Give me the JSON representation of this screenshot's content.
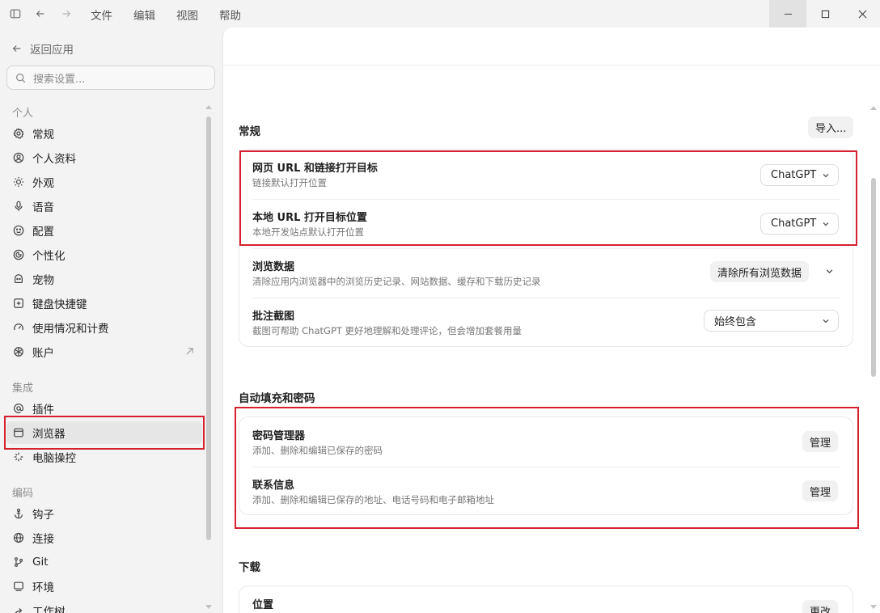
{
  "menu": [
    "文件",
    "编辑",
    "视图",
    "帮助"
  ],
  "sidebar": {
    "back_label": "返回应用",
    "search_placeholder": "搜索设置...",
    "sections": {
      "personal": "个人",
      "integration": "集成",
      "coding": "编码"
    },
    "items": [
      {
        "label": "常规",
        "icon": "gear-icon"
      },
      {
        "label": "个人资料",
        "icon": "profile-icon"
      },
      {
        "label": "外观",
        "icon": "sun-icon"
      },
      {
        "label": "语音",
        "icon": "mic-icon"
      },
      {
        "label": "配置",
        "icon": "smile-icon"
      },
      {
        "label": "个性化",
        "icon": "personalize-icon"
      },
      {
        "label": "宠物",
        "icon": "pet-icon"
      },
      {
        "label": "键盘快捷键",
        "icon": "keyboard-icon"
      },
      {
        "label": "使用情况和计费",
        "icon": "gauge-icon"
      },
      {
        "label": "账户",
        "icon": "openai-icon"
      },
      {
        "label": "插件",
        "icon": "at-icon"
      },
      {
        "label": "浏览器",
        "icon": "browser-icon"
      },
      {
        "label": "电脑操控",
        "icon": "sparkle-icon"
      },
      {
        "label": "钩子",
        "icon": "anchor-icon"
      },
      {
        "label": "连接",
        "icon": "globe-icon"
      },
      {
        "label": "Git",
        "icon": "git-icon"
      },
      {
        "label": "环境",
        "icon": "monitor-icon"
      },
      {
        "label": "工作树",
        "icon": "tree-icon"
      }
    ]
  },
  "main": {
    "general": {
      "title": "常规",
      "import_label": "导入...",
      "rows": [
        {
          "title": "网页 URL 和链接打开目标",
          "desc": "链接默认打开位置",
          "value": "ChatGPT"
        },
        {
          "title": "本地 URL 打开目标位置",
          "desc": "本地开发站点默认打开位置",
          "value": "ChatGPT"
        },
        {
          "title": "浏览数据",
          "desc": "清除应用内浏览器中的浏览历史记录、网站数据、缓存和下载历史记录",
          "value": "清除所有浏览数据"
        },
        {
          "title": "批注截图",
          "desc": "截图可帮助 ChatGPT 更好地理解和处理评论，但会增加套餐用量",
          "value": "始终包含"
        }
      ]
    },
    "autofill": {
      "title": "自动填充和密码",
      "rows": [
        {
          "title": "密码管理器",
          "desc": "添加、删除和编辑已保存的密码",
          "button": "管理"
        },
        {
          "title": "联系信息",
          "desc": "添加、删除和编辑已保存的地址、电话号码和电子邮箱地址",
          "button": "管理"
        }
      ]
    },
    "download": {
      "title": "下载",
      "rows": [
        {
          "title": "位置",
          "button": "更改"
        }
      ]
    }
  },
  "colors": {
    "highlight": "#d6202e",
    "background": "#f3f3f3",
    "panel": "#ffffff"
  }
}
